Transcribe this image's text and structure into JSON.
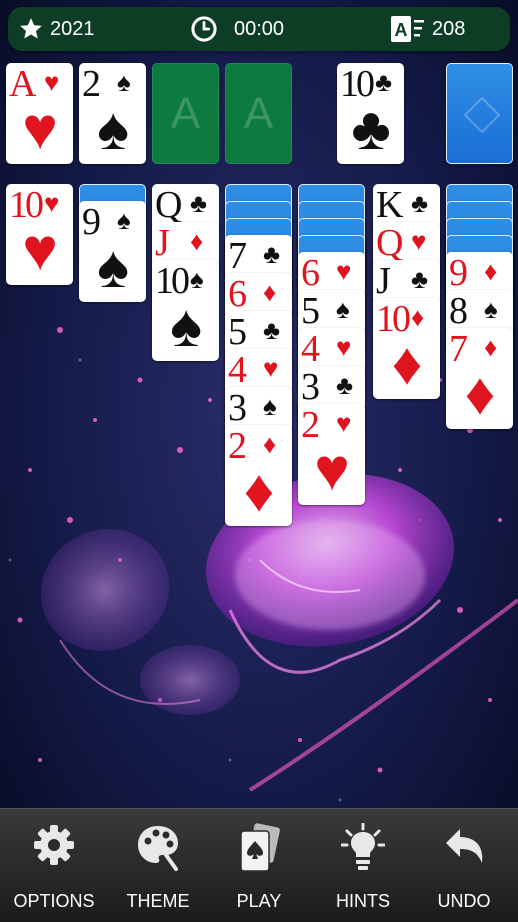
{
  "topbar": {
    "score": "2021",
    "time": "00:00",
    "moves": "208"
  },
  "stock": {
    "face_down": true
  },
  "waste": {
    "rank": "10",
    "suit": "♣",
    "color": "black"
  },
  "foundations": [
    {
      "rank": "A",
      "suit": "♥",
      "color": "red"
    },
    {
      "rank": "2",
      "suit": "♠",
      "color": "black"
    },
    {
      "empty_label": "A"
    },
    {
      "empty_label": "A"
    }
  ],
  "tableau": [
    {
      "face_down": 0,
      "cards": [
        {
          "rank": "10",
          "suit": "♥",
          "color": "red"
        }
      ]
    },
    {
      "face_down": 1,
      "cards": [
        {
          "rank": "9",
          "suit": "♠",
          "color": "black"
        }
      ]
    },
    {
      "face_down": 0,
      "cards": [
        {
          "rank": "Q",
          "suit": "♣",
          "color": "black"
        },
        {
          "rank": "J",
          "suit": "♦",
          "color": "red"
        },
        {
          "rank": "10",
          "suit": "♠",
          "color": "black"
        }
      ]
    },
    {
      "face_down": 3,
      "cards": [
        {
          "rank": "7",
          "suit": "♣",
          "color": "black"
        },
        {
          "rank": "6",
          "suit": "♦",
          "color": "red"
        },
        {
          "rank": "5",
          "suit": "♣",
          "color": "black"
        },
        {
          "rank": "4",
          "suit": "♥",
          "color": "red"
        },
        {
          "rank": "3",
          "suit": "♠",
          "color": "black"
        },
        {
          "rank": "2",
          "suit": "♦",
          "color": "red"
        }
      ]
    },
    {
      "face_down": 4,
      "cards": [
        {
          "rank": "6",
          "suit": "♥",
          "color": "red"
        },
        {
          "rank": "5",
          "suit": "♠",
          "color": "black"
        },
        {
          "rank": "4",
          "suit": "♥",
          "color": "red"
        },
        {
          "rank": "3",
          "suit": "♣",
          "color": "black"
        },
        {
          "rank": "2",
          "suit": "♥",
          "color": "red"
        }
      ]
    },
    {
      "face_down": 0,
      "cards": [
        {
          "rank": "K",
          "suit": "♣",
          "color": "black"
        },
        {
          "rank": "Q",
          "suit": "♥",
          "color": "red"
        },
        {
          "rank": "J",
          "suit": "♣",
          "color": "black"
        },
        {
          "rank": "10",
          "suit": "♦",
          "color": "red"
        }
      ]
    },
    {
      "face_down": 4,
      "cards": [
        {
          "rank": "9",
          "suit": "♦",
          "color": "red"
        },
        {
          "rank": "8",
          "suit": "♠",
          "color": "black"
        },
        {
          "rank": "7",
          "suit": "♦",
          "color": "red"
        }
      ]
    }
  ],
  "toolbar": {
    "options": "OPTIONS",
    "theme": "THEME",
    "play": "PLAY",
    "hints": "HINTS",
    "undo": "UNDO"
  },
  "icons": {
    "score": "star-icon",
    "time": "clock-icon",
    "moves": "moves-icon",
    "options": "gear-icon",
    "theme": "palette-icon",
    "play": "cards-icon",
    "hints": "lightbulb-icon",
    "undo": "undo-arrow-icon"
  },
  "colors": {
    "topbar": "#0d3d25",
    "slot": "#0d7a3f",
    "card_back": "#1a6ed4",
    "red_suit": "#e0141e"
  }
}
